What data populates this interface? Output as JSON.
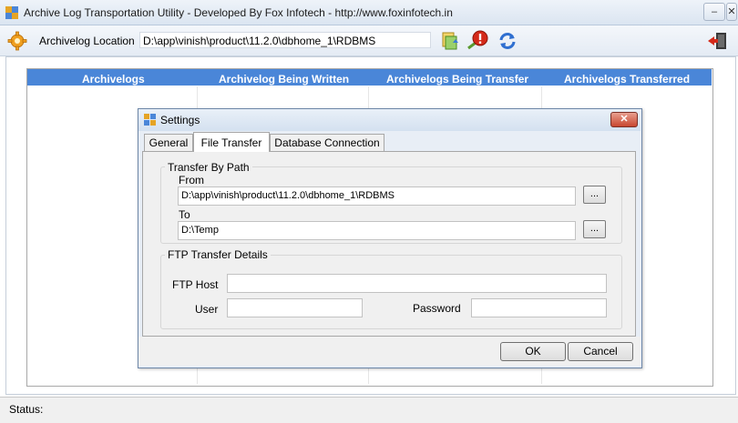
{
  "window": {
    "title": "Archive Log Transportation Utility - Developed By Fox Infotech - http://www.foxinfotech.in",
    "minimize_label": "–",
    "close_label": "✕"
  },
  "toolbar": {
    "location_label": "Archivelog Location",
    "location_value": "D:\\app\\vinish\\product\\11.2.0\\dbhome_1\\RDBMS"
  },
  "grid": {
    "columns": [
      "Archivelogs",
      "Archivelog Being Written",
      "Archivelogs Being Transfer",
      "Archivelogs Transferred"
    ]
  },
  "status": {
    "label": "Status:"
  },
  "dialog": {
    "title": "Settings",
    "close_label": "✕",
    "tabs": [
      "General",
      "File Transfer",
      "Database Connection"
    ],
    "active_tab": "File Transfer",
    "transfer_group": {
      "title": "Transfer By Path",
      "from_label": "From",
      "from_value": "D:\\app\\vinish\\product\\11.2.0\\dbhome_1\\RDBMS",
      "to_label": "To",
      "to_value": "D:\\Temp",
      "browse_label": "..."
    },
    "ftp_group": {
      "title": "FTP Transfer Details",
      "host_label": "FTP Host",
      "host_value": "",
      "user_label": "User",
      "user_value": "",
      "password_label": "Password",
      "password_value": ""
    },
    "ok_label": "OK",
    "cancel_label": "Cancel"
  },
  "colors": {
    "grid_header": "#4a86d8",
    "dialog_bg": "#f0f0f0",
    "close_red": "#c8462f"
  },
  "icons": [
    "app-icon",
    "settings-gear-icon",
    "transfer-icon",
    "alert-icon",
    "refresh-icon",
    "exit-icon"
  ]
}
